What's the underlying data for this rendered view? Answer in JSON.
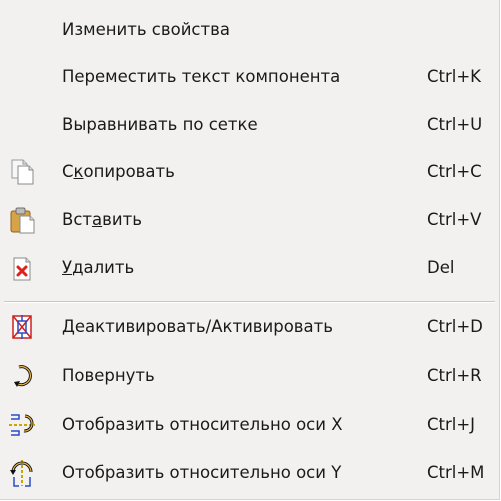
{
  "context_menu": {
    "items": [
      {
        "label": "Изменить свойства",
        "shortcut": "",
        "icon": ""
      },
      {
        "label": "Переместить текст компонента",
        "shortcut": "Ctrl+K",
        "icon": ""
      },
      {
        "label": "Выравнивать по сетке",
        "shortcut": "Ctrl+U",
        "icon": ""
      },
      {
        "label_pre": "С",
        "label_mn": "к",
        "label_post": "опировать",
        "shortcut": "Ctrl+C",
        "icon": "copy-icon"
      },
      {
        "label_pre": "Вст",
        "label_mn": "а",
        "label_post": "вить",
        "shortcut": "Ctrl+V",
        "icon": "paste-icon"
      },
      {
        "label_pre": "",
        "label_mn": "У",
        "label_post": "далить",
        "shortcut": "Del",
        "icon": "delete-icon"
      },
      {
        "label": "Деактивировать/Активировать",
        "shortcut": "Ctrl+D",
        "icon": "deactivate-icon"
      },
      {
        "label": "Повернуть",
        "shortcut": "Ctrl+R",
        "icon": "rotate-icon"
      },
      {
        "label": "Отобразить относительно оси X",
        "shortcut": "Ctrl+J",
        "icon": "mirror-x-icon"
      },
      {
        "label": "Отобразить относительно оси Y",
        "shortcut": "Ctrl+M",
        "icon": "mirror-y-icon"
      }
    ]
  },
  "colors": {
    "menu_background": "#f2f1f0",
    "text": "#1a1a1a",
    "separator": "#c9c7c4",
    "delete_red": "#e0201b"
  }
}
